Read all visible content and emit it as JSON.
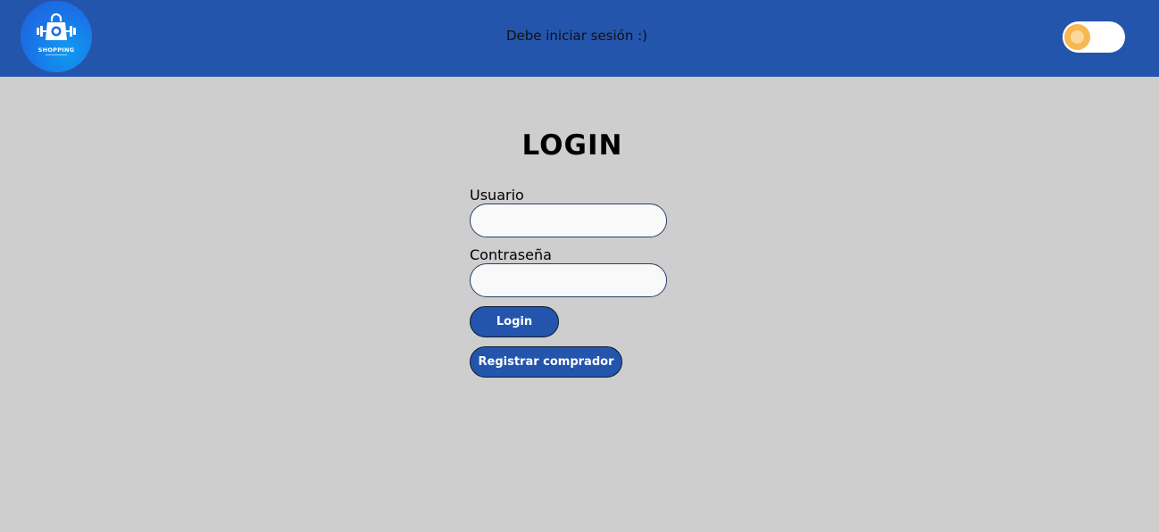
{
  "header": {
    "logo_text": "SHOPPING",
    "message": "Debe iniciar sesión :)",
    "theme_toggle_icon": "sun-toggle-icon"
  },
  "login": {
    "title": "LOGIN",
    "username_label": "Usuario",
    "username_value": "",
    "password_label": "Contraseña",
    "password_value": "",
    "login_button": "Login",
    "register_button": "Registrar comprador"
  },
  "colors": {
    "header_bg": "#2455ad",
    "page_bg": "#cecece",
    "button_bg": "#2455ad",
    "toggle_knob": "#f7b84f"
  }
}
